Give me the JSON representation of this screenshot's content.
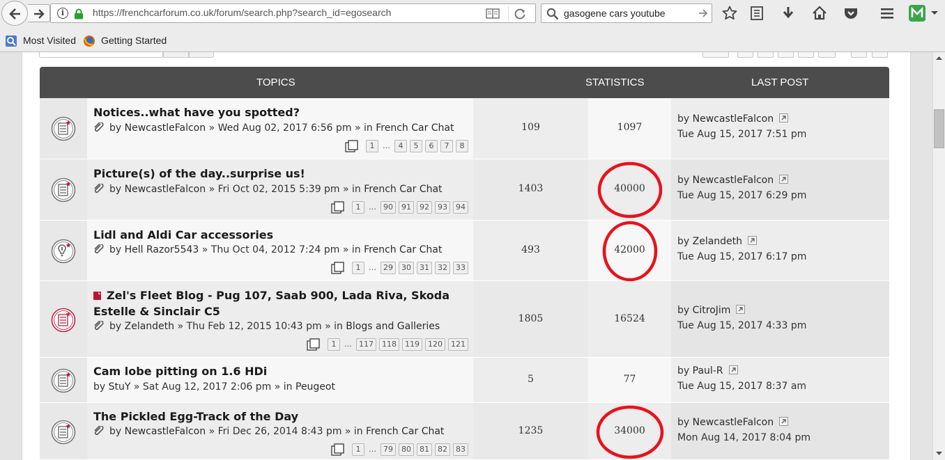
{
  "browser": {
    "url": "https://frenchcarforum.co.uk/forum/search.php?search_id=egosearch",
    "search_query": "gasogene cars youtube",
    "bookmarks": [
      "Most Visited",
      "Getting Started"
    ]
  },
  "table": {
    "headers": {
      "topics": "TOPICS",
      "statistics": "STATISTICS",
      "last_post": "LAST POST"
    },
    "rows": [
      {
        "title": "Notices..what have you spotted?",
        "meta_by": "by",
        "author": "NewcastleFalcon",
        "date": "» Wed Aug 02, 2017 6:56 pm » in",
        "forum": "French Car Chat",
        "pages": [
          "1",
          "…",
          "4",
          "5",
          "6",
          "7",
          "8"
        ],
        "replies": "109",
        "views": "1097",
        "last_by": "by",
        "last_author": "NewcastleFalcon",
        "last_time": "Tue Aug 15, 2017 7:51 pm",
        "icon": "topic-read-icon",
        "circled": false
      },
      {
        "title": "Picture(s) of the day..surprise us!",
        "meta_by": "by",
        "author": "NewcastleFalcon",
        "date": "» Fri Oct 02, 2015 5:39 pm » in",
        "forum": "French Car Chat",
        "pages": [
          "1",
          "…",
          "90",
          "91",
          "92",
          "93",
          "94"
        ],
        "replies": "1403",
        "views": "40000",
        "last_by": "by",
        "last_author": "NewcastleFalcon",
        "last_time": "Tue Aug 15, 2017 6:29 pm",
        "icon": "topic-read-icon",
        "circled": true
      },
      {
        "title": "Lidl and Aldi Car accessories",
        "meta_by": "by",
        "author": "Hell Razor5543",
        "date": "» Thu Oct 04, 2012 7:24 pm » in",
        "forum": "French Car Chat",
        "pages": [
          "1",
          "…",
          "29",
          "30",
          "31",
          "32",
          "33"
        ],
        "replies": "493",
        "views": "42000",
        "last_by": "by",
        "last_author": "Zelandeth",
        "last_time": "Tue Aug 15, 2017 6:17 pm",
        "icon": "topic-hot-icon",
        "circled": true
      },
      {
        "title": "Zel's Fleet Blog - Pug 107, Saab 900, Lada Riva, Skoda Estelle & Sinclair C5",
        "meta_by": "by",
        "author": "Zelandeth",
        "date": "» Thu Feb 12, 2015 10:43 pm » in",
        "forum": "Blogs and Galleries",
        "pages": [
          "1",
          "…",
          "117",
          "118",
          "119",
          "120",
          "121"
        ],
        "replies": "1805",
        "views": "16524",
        "last_by": "by",
        "last_author": "CitroJim",
        "last_time": "Tue Aug 15, 2017 4:33 pm",
        "icon": "topic-unread-icon",
        "circled": false
      },
      {
        "title": "Cam lobe pitting on 1.6 HDi",
        "meta_by": "by",
        "author": "StuY",
        "date": "» Sat Aug 12, 2017 2:06 pm » in",
        "forum": "Peugeot",
        "pages": [],
        "replies": "5",
        "views": "77",
        "last_by": "by",
        "last_author": "Paul-R",
        "last_time": "Tue Aug 15, 2017 8:37 am",
        "icon": "topic-read-icon",
        "circled": false
      },
      {
        "title": "The Pickled Egg-Track of the Day",
        "meta_by": "by",
        "author": "NewcastleFalcon",
        "date": "» Fri Dec 26, 2014 8:43 pm » in",
        "forum": "French Car Chat",
        "pages": [
          "1",
          "…",
          "79",
          "80",
          "81",
          "82",
          "83"
        ],
        "replies": "1235",
        "views": "34000",
        "last_by": "by",
        "last_author": "NewcastleFalcon",
        "last_time": "Mon Aug 14, 2017 8:04 pm",
        "icon": "topic-read-icon",
        "circled": true
      }
    ]
  },
  "colors": {
    "header_bg": "#4c4c4c",
    "circle": "#e8121c",
    "unread": "#b8173a"
  }
}
